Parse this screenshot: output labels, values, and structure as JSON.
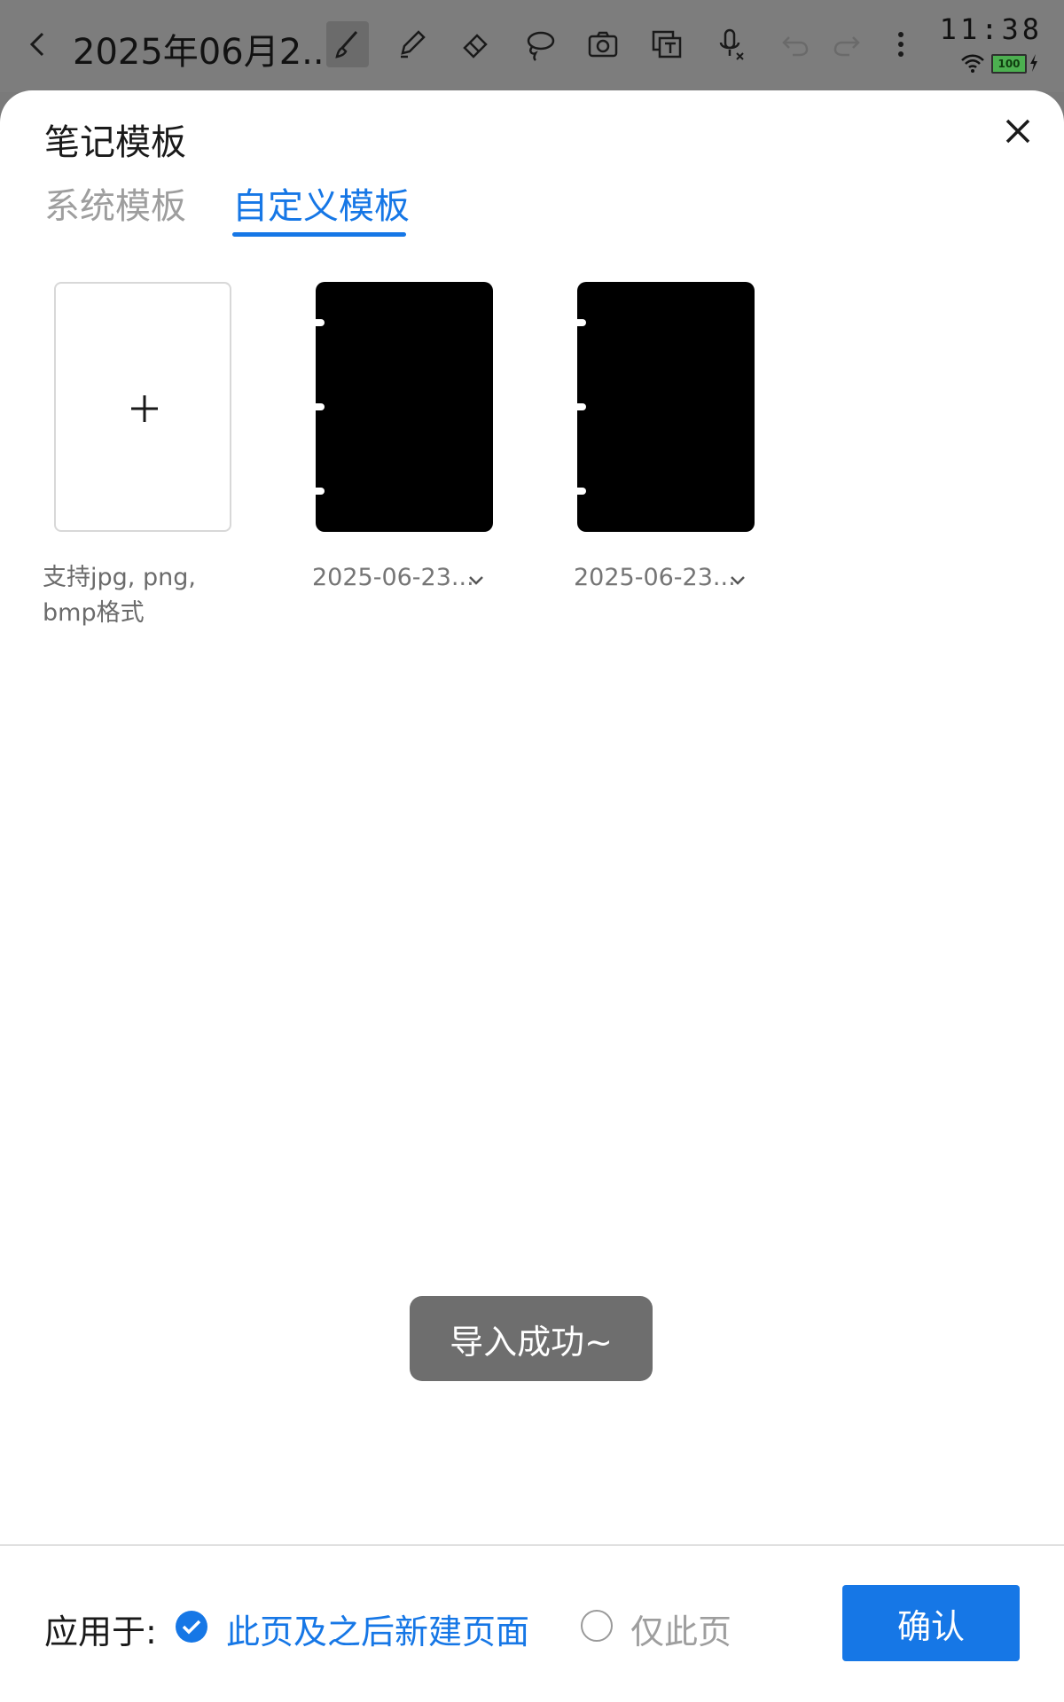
{
  "toolbar": {
    "title": "2025年06月2...",
    "tools": [
      {
        "icon": "brush-icon",
        "active": true
      },
      {
        "icon": "pen-icon",
        "active": false
      },
      {
        "icon": "eraser-icon",
        "active": false
      },
      {
        "icon": "lasso-icon",
        "active": false
      },
      {
        "icon": "camera-icon",
        "active": false
      },
      {
        "icon": "text-box-icon",
        "active": false
      },
      {
        "icon": "microphone-icon",
        "active": false
      },
      {
        "icon": "undo-icon",
        "active": false
      },
      {
        "icon": "redo-icon",
        "active": false
      },
      {
        "icon": "more-icon",
        "active": false
      }
    ]
  },
  "status": {
    "time": "11:38",
    "battery": "100"
  },
  "sheet": {
    "title": "笔记模板",
    "tabs": [
      {
        "label": "系统模板",
        "selected": false
      },
      {
        "label": "自定义模板",
        "selected": true
      }
    ],
    "add_hint": "支持jpg, png, bmp格式",
    "templates": [
      {
        "label": "2025-06-23..."
      },
      {
        "label": "2025-06-23..."
      }
    ]
  },
  "toast": "导入成功~",
  "footer": {
    "apply_label": "应用于:",
    "option_1": "此页及之后新建页面",
    "option_2": "仅此页",
    "confirm": "确认"
  },
  "colors": {
    "accent": "#1677e6",
    "toolbar_bg": "#7d7d7d",
    "toast_bg": "#6e6e6e"
  }
}
